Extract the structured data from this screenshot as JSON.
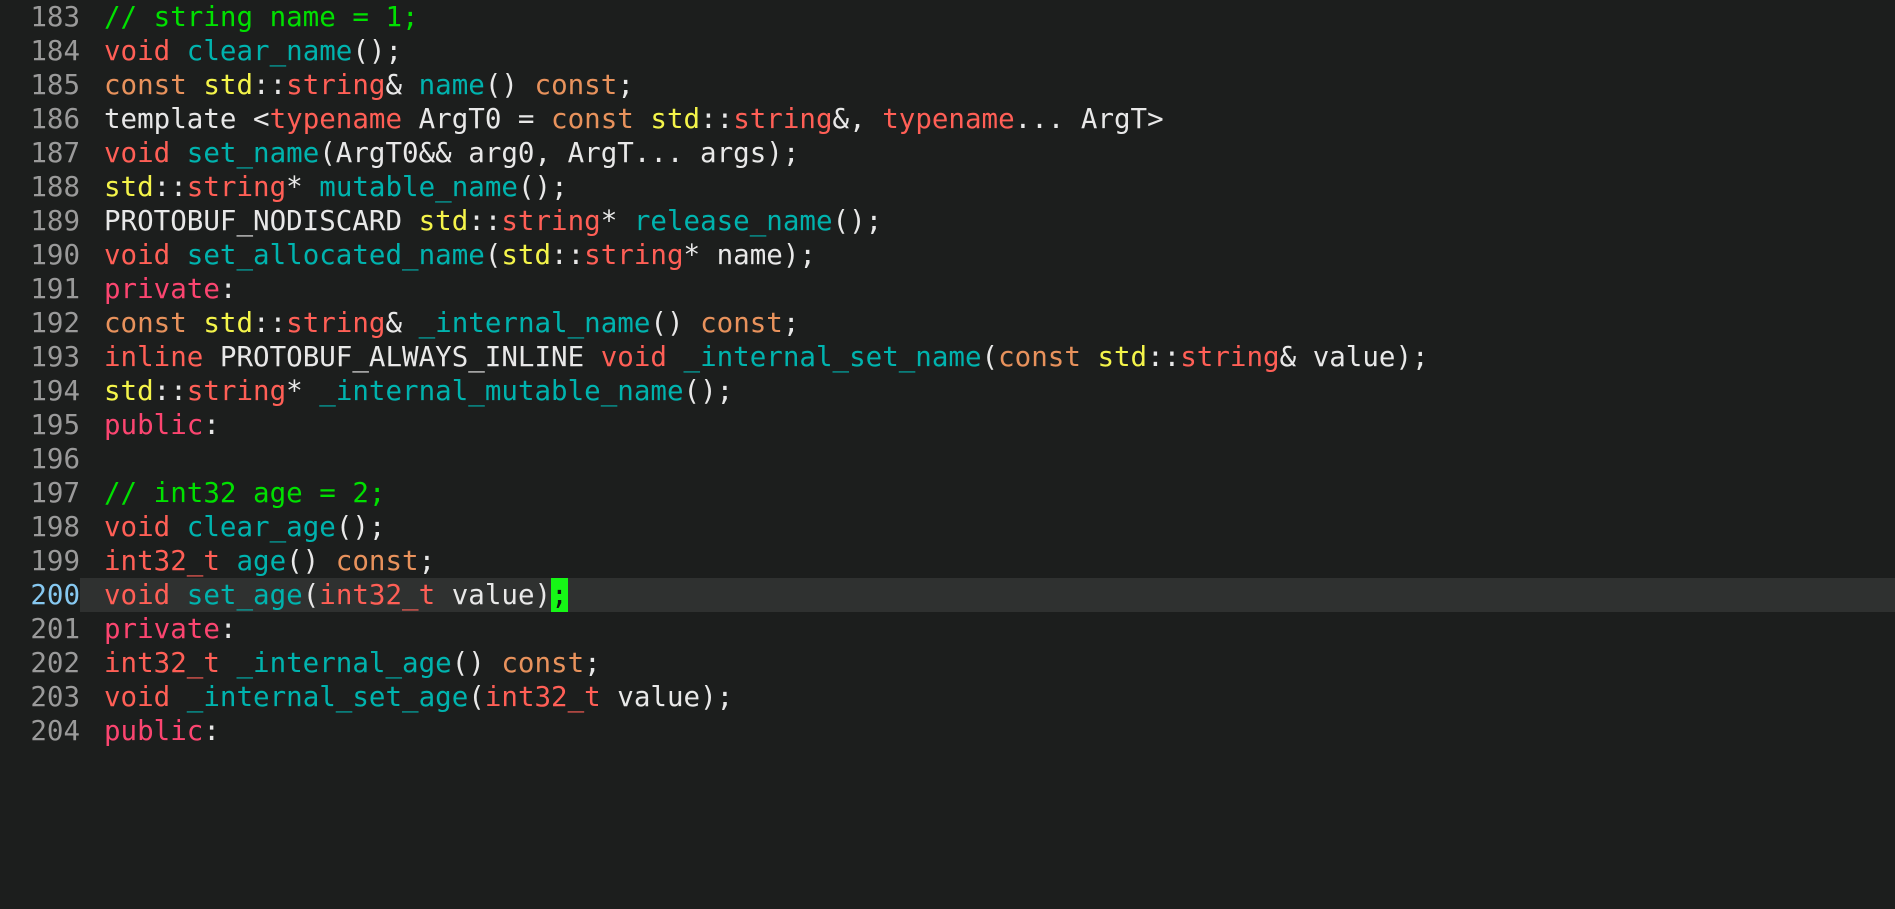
{
  "editor": {
    "theme": "dark",
    "background": "#1c1e1d",
    "current_line_background": "#2f3130",
    "gutter_color": "#9a9a9a",
    "current_line_number_color": "#86c8f0",
    "cursor_color": "#16f616",
    "language": "C++",
    "first_visible_line": 183,
    "last_visible_line": 204,
    "cursor_line": 200,
    "cursor_character": ";"
  },
  "colors": {
    "comment": "#00e000",
    "keyword": "#ff5f56",
    "namespace": "#f4f44a",
    "const": "#e8925c",
    "function": "#00b3ae",
    "access_specifier": "#fb4570",
    "plain": "#e8e8e8"
  },
  "lines": [
    {
      "number": "183",
      "current": false,
      "tokens": [
        {
          "text": "// string name = 1;",
          "cls": "t-comment"
        }
      ]
    },
    {
      "number": "184",
      "current": false,
      "tokens": [
        {
          "text": "void ",
          "cls": "t-keyword"
        },
        {
          "text": "clear_name",
          "cls": "t-func"
        },
        {
          "text": "();",
          "cls": "t-plain"
        }
      ]
    },
    {
      "number": "185",
      "current": false,
      "tokens": [
        {
          "text": "const ",
          "cls": "t-const"
        },
        {
          "text": "std",
          "cls": "t-ns"
        },
        {
          "text": "::",
          "cls": "t-plain"
        },
        {
          "text": "string",
          "cls": "t-keyword"
        },
        {
          "text": "& ",
          "cls": "t-plain"
        },
        {
          "text": "name",
          "cls": "t-func"
        },
        {
          "text": "() ",
          "cls": "t-plain"
        },
        {
          "text": "const",
          "cls": "t-const"
        },
        {
          "text": ";",
          "cls": "t-plain"
        }
      ]
    },
    {
      "number": "186",
      "current": false,
      "tokens": [
        {
          "text": "template <",
          "cls": "t-plain"
        },
        {
          "text": "typename",
          "cls": "t-keyword"
        },
        {
          "text": " ArgT0 = ",
          "cls": "t-plain"
        },
        {
          "text": "const ",
          "cls": "t-const"
        },
        {
          "text": "std",
          "cls": "t-ns"
        },
        {
          "text": "::",
          "cls": "t-plain"
        },
        {
          "text": "string",
          "cls": "t-keyword"
        },
        {
          "text": "&, ",
          "cls": "t-plain"
        },
        {
          "text": "typename",
          "cls": "t-keyword"
        },
        {
          "text": "... ArgT>",
          "cls": "t-plain"
        }
      ]
    },
    {
      "number": "187",
      "current": false,
      "tokens": [
        {
          "text": "void ",
          "cls": "t-keyword"
        },
        {
          "text": "set_name",
          "cls": "t-func"
        },
        {
          "text": "(ArgT0&& arg0, ArgT... args);",
          "cls": "t-plain"
        }
      ]
    },
    {
      "number": "188",
      "current": false,
      "tokens": [
        {
          "text": "std",
          "cls": "t-ns"
        },
        {
          "text": "::",
          "cls": "t-plain"
        },
        {
          "text": "string",
          "cls": "t-keyword"
        },
        {
          "text": "* ",
          "cls": "t-plain"
        },
        {
          "text": "mutable_name",
          "cls": "t-func"
        },
        {
          "text": "();",
          "cls": "t-plain"
        }
      ]
    },
    {
      "number": "189",
      "current": false,
      "tokens": [
        {
          "text": "PROTOBUF_NODISCARD ",
          "cls": "t-macro"
        },
        {
          "text": "std",
          "cls": "t-ns"
        },
        {
          "text": "::",
          "cls": "t-plain"
        },
        {
          "text": "string",
          "cls": "t-keyword"
        },
        {
          "text": "* ",
          "cls": "t-plain"
        },
        {
          "text": "release_name",
          "cls": "t-func"
        },
        {
          "text": "();",
          "cls": "t-plain"
        }
      ]
    },
    {
      "number": "190",
      "current": false,
      "tokens": [
        {
          "text": "void ",
          "cls": "t-keyword"
        },
        {
          "text": "set_allocated_name",
          "cls": "t-func"
        },
        {
          "text": "(",
          "cls": "t-plain"
        },
        {
          "text": "std",
          "cls": "t-ns"
        },
        {
          "text": "::",
          "cls": "t-plain"
        },
        {
          "text": "string",
          "cls": "t-keyword"
        },
        {
          "text": "* name);",
          "cls": "t-plain"
        }
      ]
    },
    {
      "number": "191",
      "current": false,
      "tokens": [
        {
          "text": "private",
          "cls": "t-access"
        },
        {
          "text": ":",
          "cls": "t-plain"
        }
      ]
    },
    {
      "number": "192",
      "current": false,
      "tokens": [
        {
          "text": "const ",
          "cls": "t-const"
        },
        {
          "text": "std",
          "cls": "t-ns"
        },
        {
          "text": "::",
          "cls": "t-plain"
        },
        {
          "text": "string",
          "cls": "t-keyword"
        },
        {
          "text": "& ",
          "cls": "t-plain"
        },
        {
          "text": "_internal_name",
          "cls": "t-func"
        },
        {
          "text": "() ",
          "cls": "t-plain"
        },
        {
          "text": "const",
          "cls": "t-const"
        },
        {
          "text": ";",
          "cls": "t-plain"
        }
      ]
    },
    {
      "number": "193",
      "current": false,
      "tokens": [
        {
          "text": "inline ",
          "cls": "t-keyword"
        },
        {
          "text": "PROTOBUF_ALWAYS_INLINE ",
          "cls": "t-macro"
        },
        {
          "text": "void ",
          "cls": "t-keyword"
        },
        {
          "text": "_internal_set_name",
          "cls": "t-func"
        },
        {
          "text": "(",
          "cls": "t-plain"
        },
        {
          "text": "const ",
          "cls": "t-const"
        },
        {
          "text": "std",
          "cls": "t-ns"
        },
        {
          "text": "::",
          "cls": "t-plain"
        },
        {
          "text": "string",
          "cls": "t-keyword"
        },
        {
          "text": "& value);",
          "cls": "t-plain"
        }
      ]
    },
    {
      "number": "194",
      "current": false,
      "tokens": [
        {
          "text": "std",
          "cls": "t-ns"
        },
        {
          "text": "::",
          "cls": "t-plain"
        },
        {
          "text": "string",
          "cls": "t-keyword"
        },
        {
          "text": "* ",
          "cls": "t-plain"
        },
        {
          "text": "_internal_mutable_name",
          "cls": "t-func"
        },
        {
          "text": "();",
          "cls": "t-plain"
        }
      ]
    },
    {
      "number": "195",
      "current": false,
      "tokens": [
        {
          "text": "public",
          "cls": "t-access"
        },
        {
          "text": ":",
          "cls": "t-plain"
        }
      ]
    },
    {
      "number": "196",
      "current": false,
      "tokens": []
    },
    {
      "number": "197",
      "current": false,
      "tokens": [
        {
          "text": "// int32 age = 2;",
          "cls": "t-comment"
        }
      ]
    },
    {
      "number": "198",
      "current": false,
      "tokens": [
        {
          "text": "void ",
          "cls": "t-keyword"
        },
        {
          "text": "clear_age",
          "cls": "t-func"
        },
        {
          "text": "();",
          "cls": "t-plain"
        }
      ]
    },
    {
      "number": "199",
      "current": false,
      "tokens": [
        {
          "text": "int32_t ",
          "cls": "t-keyword"
        },
        {
          "text": "age",
          "cls": "t-func"
        },
        {
          "text": "() ",
          "cls": "t-plain"
        },
        {
          "text": "const",
          "cls": "t-const"
        },
        {
          "text": ";",
          "cls": "t-plain"
        }
      ]
    },
    {
      "number": "200",
      "current": true,
      "tokens": [
        {
          "text": "void ",
          "cls": "t-keyword"
        },
        {
          "text": "set_age",
          "cls": "t-func"
        },
        {
          "text": "(",
          "cls": "t-plain"
        },
        {
          "text": "int32_t",
          "cls": "t-keyword"
        },
        {
          "text": " value)",
          "cls": "t-plain"
        },
        {
          "text": ";",
          "cls": "cursor"
        }
      ]
    },
    {
      "number": "201",
      "current": false,
      "tokens": [
        {
          "text": "private",
          "cls": "t-access"
        },
        {
          "text": ":",
          "cls": "t-plain"
        }
      ]
    },
    {
      "number": "202",
      "current": false,
      "tokens": [
        {
          "text": "int32_t ",
          "cls": "t-keyword"
        },
        {
          "text": "_internal_age",
          "cls": "t-func"
        },
        {
          "text": "() ",
          "cls": "t-plain"
        },
        {
          "text": "const",
          "cls": "t-const"
        },
        {
          "text": ";",
          "cls": "t-plain"
        }
      ]
    },
    {
      "number": "203",
      "current": false,
      "tokens": [
        {
          "text": "void ",
          "cls": "t-keyword"
        },
        {
          "text": "_internal_set_age",
          "cls": "t-func"
        },
        {
          "text": "(",
          "cls": "t-plain"
        },
        {
          "text": "int32_t",
          "cls": "t-keyword"
        },
        {
          "text": " value);",
          "cls": "t-plain"
        }
      ]
    },
    {
      "number": "204",
      "current": false,
      "tokens": [
        {
          "text": "public",
          "cls": "t-access"
        },
        {
          "text": ":",
          "cls": "t-plain"
        }
      ]
    }
  ]
}
